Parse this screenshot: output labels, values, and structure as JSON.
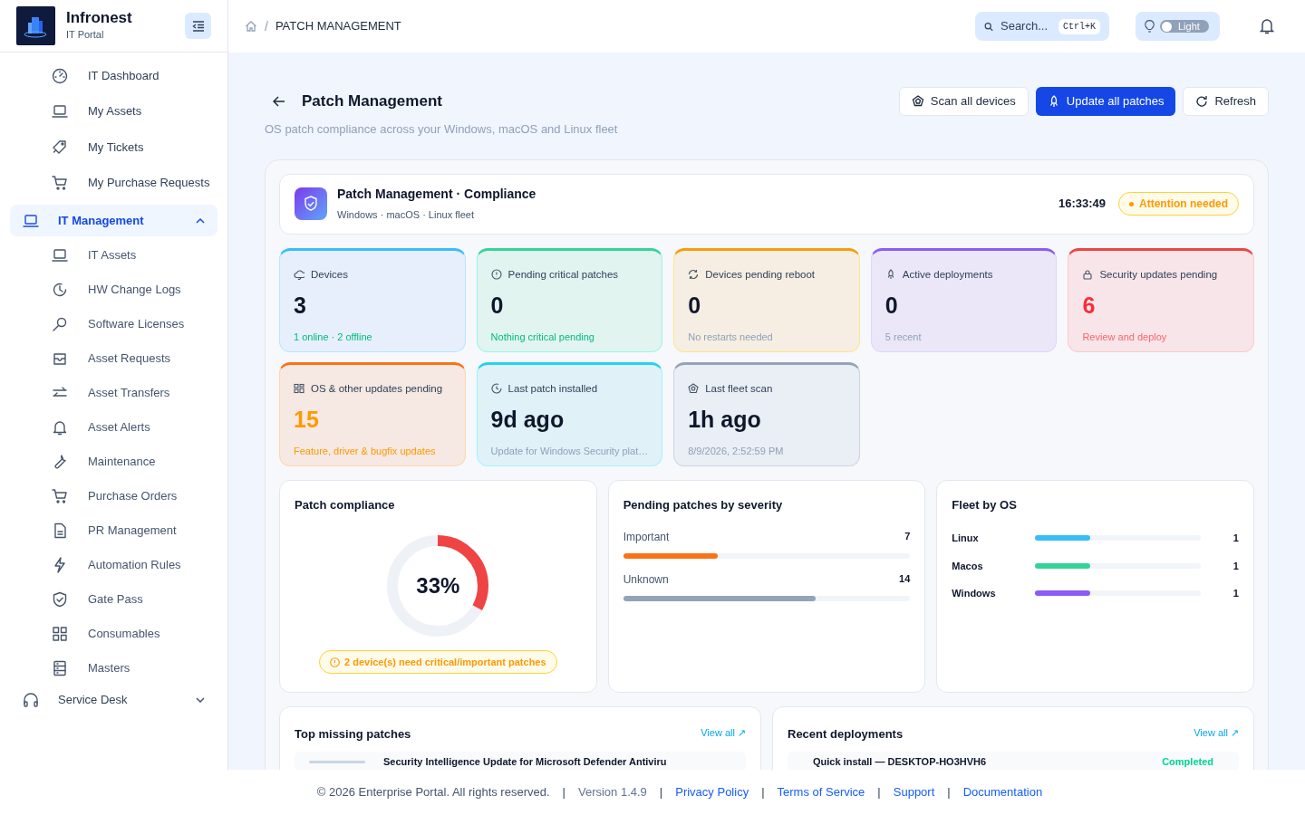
{
  "brand": {
    "name": "Infronest",
    "subtitle": "IT Portal"
  },
  "sidebar": {
    "items": [
      {
        "label": "IT Dashboard",
        "selected": false
      },
      {
        "label": "My Assets",
        "selected": false
      },
      {
        "label": "My Tickets",
        "selected": false
      },
      {
        "label": "My Purchase Requests",
        "selected": false
      },
      {
        "label": "IT Management",
        "selected": true,
        "expanded": true,
        "children": [
          {
            "label": "IT Assets",
            "selected": false
          },
          {
            "label": "HW Change Logs",
            "selected": false
          },
          {
            "label": "Software Licenses",
            "selected": false
          },
          {
            "label": "Asset Requests",
            "selected": false
          },
          {
            "label": "Asset Transfers",
            "selected": false
          },
          {
            "label": "Asset Alerts",
            "selected": false
          },
          {
            "label": "Maintenance",
            "selected": false
          },
          {
            "label": "Purchase Orders",
            "selected": false
          },
          {
            "label": "PR Management",
            "selected": false
          },
          {
            "label": "Automation Rules",
            "selected": false
          },
          {
            "label": "Gate Pass",
            "selected": false
          },
          {
            "label": "Consumables",
            "selected": false
          },
          {
            "label": "Masters",
            "selected": false
          }
        ]
      },
      {
        "label": "Service Desk",
        "selected": false,
        "expanded": false
      }
    ]
  },
  "breadcrumb": {
    "separator": "/",
    "current": "PATCH MANAGEMENT"
  },
  "search": {
    "placeholder": "Search...",
    "shortcut": "Ctrl+K"
  },
  "theme_toggle": {
    "label": "Light",
    "on": false
  },
  "page": {
    "title": "Patch Management",
    "subtitle": "OS patch compliance across your Windows, macOS and Linux fleet",
    "actions": [
      {
        "label": "Scan all devices",
        "primary": false
      },
      {
        "label": "Update all patches",
        "primary": true
      },
      {
        "label": "Refresh",
        "primary": false
      }
    ]
  },
  "banner": {
    "title": "Patch Management · Compliance",
    "subtitle": "Windows · macOS · Linux fleet",
    "time": "16:33:49",
    "status": "Attention needed"
  },
  "stats": [
    {
      "label": "Devices",
      "value": "3",
      "note": "1 online · 2 offline",
      "color": "#38bdf8"
    },
    {
      "label": "Pending critical patches",
      "value": "0",
      "note": "Nothing critical pending",
      "color": "#34d399"
    },
    {
      "label": "Devices pending reboot",
      "value": "0",
      "note": "No restarts needed",
      "color": "#f59e0b"
    },
    {
      "label": "Active deployments",
      "value": "0",
      "note": "5 recent",
      "color": "#8b5cf6"
    },
    {
      "label": "Security updates pending",
      "value": "6",
      "note": "Review and deploy",
      "color": "#ef4444"
    },
    {
      "label": "OS & other updates pending",
      "value": "15",
      "note": "Feature, driver & bugfix updates",
      "color": "#f97316"
    },
    {
      "label": "Last patch installed",
      "value": "9d ago",
      "note": "Update for Windows Security plat…",
      "color": "#22d3ee"
    },
    {
      "label": "Last fleet scan",
      "value": "1h ago",
      "note": "8/9/2026, 2:52:59 PM",
      "color": "#94a3b8"
    }
  ],
  "compliance": {
    "title": "Patch compliance",
    "value": "33%",
    "level": 0.33,
    "warning": "2 device(s) need critical/important patches"
  },
  "severity": {
    "title": "Pending patches by severity",
    "rows": [
      {
        "label": "Important",
        "count": "7",
        "level": 0.33,
        "color": "#f97316"
      },
      {
        "label": "Unknown",
        "count": "14",
        "level": 0.67,
        "color": "#94a3b8"
      }
    ]
  },
  "fleet": {
    "title": "Fleet by OS",
    "rows": [
      {
        "label": "Linux",
        "count": "1",
        "level": 0.33,
        "color": "#38bdf8"
      },
      {
        "label": "Macos",
        "count": "1",
        "level": 0.33,
        "color": "#34d399"
      },
      {
        "label": "Windows",
        "count": "1",
        "level": 0.33,
        "color": "#8b5cf6"
      }
    ]
  },
  "missing": {
    "title": "Top missing patches",
    "link": "View all ↗",
    "rows": [
      {
        "name": "Security Intelligence Update for Microsoft Defender Antiviru"
      }
    ]
  },
  "deployments": {
    "title": "Recent deployments",
    "link": "View all ↗",
    "rows": [
      {
        "name": "Quick install — DESKTOP-HO3HVH6",
        "status": "Completed"
      }
    ]
  },
  "footer": {
    "separator": "|",
    "copyright": "© 2026 Enterprise Portal. All rights reserved.",
    "version": "Version 1.4.9",
    "links": [
      "Privacy Policy",
      "Terms of Service",
      "Support",
      "Documentation"
    ]
  }
}
